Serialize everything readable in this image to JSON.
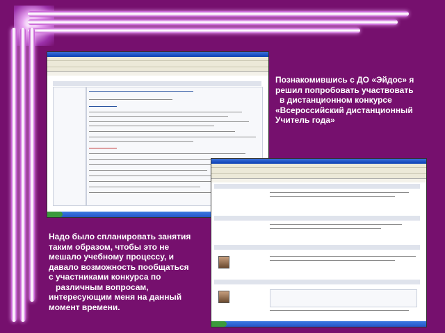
{
  "caption_right": {
    "lines": [
      "Познакомившись с ДО «Эйдос» я",
      "решил попробовать участвовать",
      "в дистанционном конкурсе",
      "«Всероссийский дистанционный",
      "Учитель года»"
    ]
  },
  "caption_left": {
    "lines": [
      "Надо было спланировать занятия",
      "таким образом, чтобы это не",
      "мешало учебному процессу, и",
      "давало возможность пообщаться",
      "с участниками конкурса по",
      "различным вопросам,",
      "интересующим меня на данный",
      "момент времени."
    ]
  },
  "colors": {
    "background": "#76106e",
    "glow": "#ffffff",
    "caption_text": "#ffffff"
  }
}
